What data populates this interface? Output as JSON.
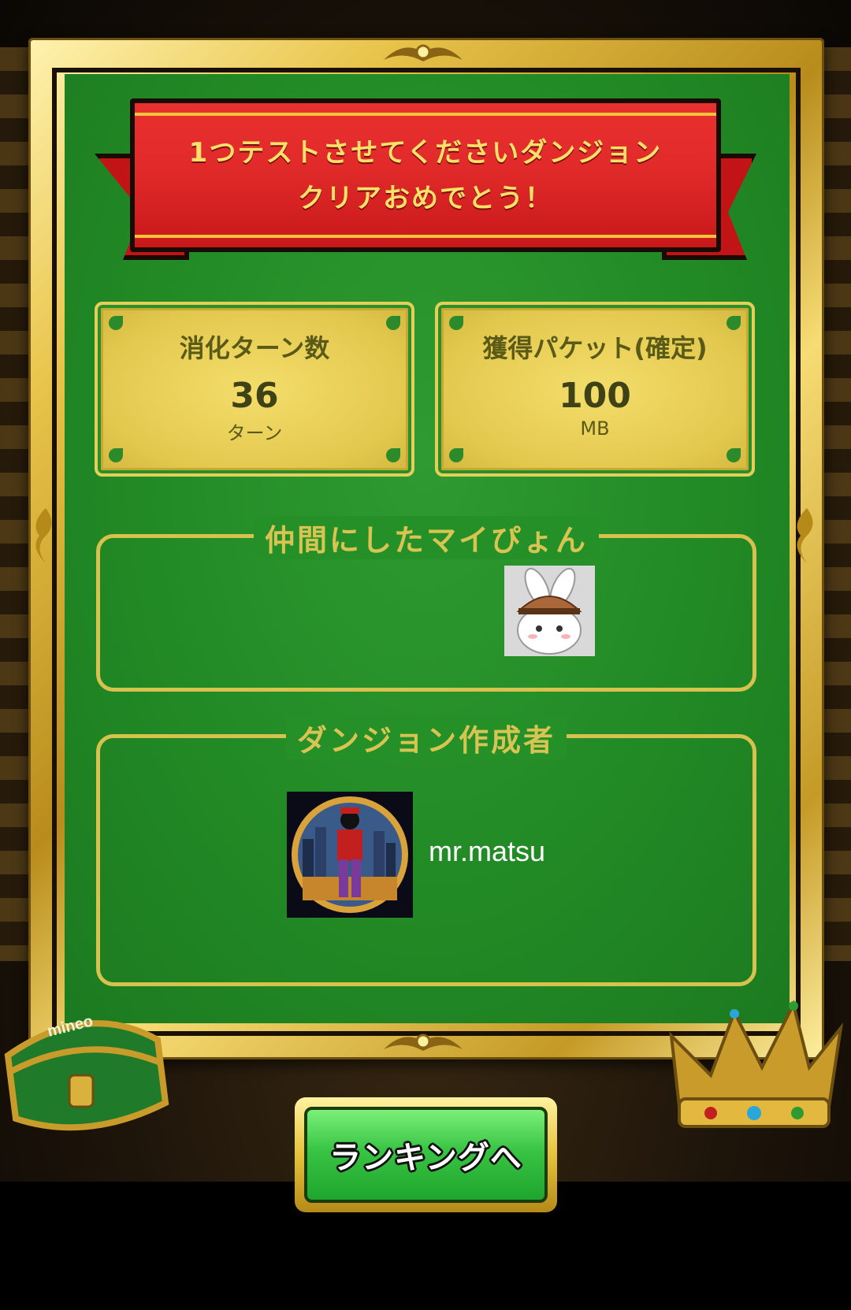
{
  "banner": {
    "line1": "1つテストさせてくださいダンジョン",
    "line2": "クリアおめでとう！"
  },
  "stats": {
    "turns": {
      "label": "消化ターン数",
      "value": "36",
      "unit": "ターン"
    },
    "packet": {
      "label": "獲得パケット(確定)",
      "value": "100",
      "unit": "MB"
    }
  },
  "companion": {
    "title": "仲間にしたマイぴょん",
    "icon": "bunny-with-hat-avatar"
  },
  "creator": {
    "title": "ダンジョン作成者",
    "name": "mr.matsu",
    "icon": "stained-glass-avatar"
  },
  "ranking_button": {
    "label": "ランキングへ"
  },
  "decorations": {
    "chest_label": "mineo",
    "colors": {
      "felt": "#228a25",
      "gold": "#e3c84e",
      "ribbon": "#e12a2a",
      "button": "#39c443"
    }
  }
}
